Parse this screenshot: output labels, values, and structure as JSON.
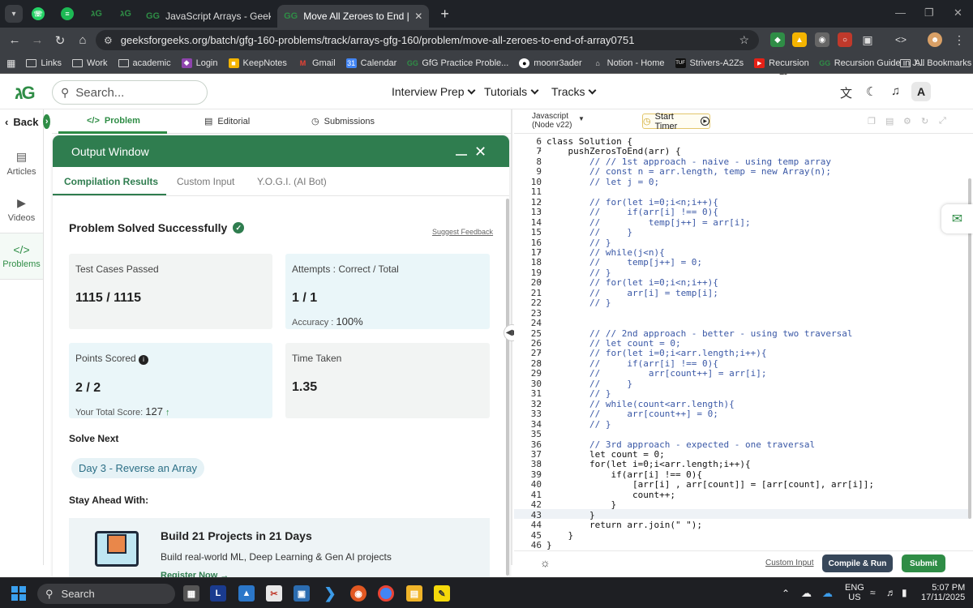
{
  "browser": {
    "tabs": [
      {
        "label": "JavaScript Arrays - GeeksforGee",
        "active": false
      },
      {
        "label": "Move All Zeroes to End | Practic",
        "active": true
      }
    ],
    "url": "geeksforgeeks.org/batch/gfg-160-problems/track/arrays-gfg-160/problem/move-all-zeroes-to-end-of-array0751",
    "extension_badge": "4"
  },
  "bookmarks": [
    "Links",
    "Work",
    "academic",
    "Login",
    "KeepNotes",
    "Gmail",
    "Calendar",
    "GfG Practice Proble...",
    "moonr3ader",
    "Notion - Home",
    "Strivers-A2Zs",
    "Recursion",
    "Recursion Guide in J...",
    "All Bookmarks"
  ],
  "header": {
    "search_placeholder": "Search...",
    "nav": [
      "Interview Prep",
      "Tutorials",
      "Tracks"
    ],
    "avatar": "A"
  },
  "sidebar": {
    "back": "Back",
    "items": [
      {
        "label": "Articles",
        "icon": "book-icon"
      },
      {
        "label": "Videos",
        "icon": "video-icon"
      },
      {
        "label": "Problems",
        "icon": "code-icon"
      }
    ]
  },
  "problem_tabs": [
    "Problem",
    "Editorial",
    "Submissions"
  ],
  "output": {
    "title": "Output Window",
    "tabs": [
      "Compilation Results",
      "Custom Input",
      "Y.O.G.I. (AI Bot)"
    ],
    "status": "Problem Solved Successfully",
    "feedback": "Suggest Feedback",
    "cards": {
      "tests_label": "Test Cases Passed",
      "tests_value": "1115 / 1115",
      "attempts_label": "Attempts : Correct / Total",
      "attempts_value": "1 / 1",
      "accuracy_label": "Accuracy :",
      "accuracy_value": "100%",
      "points_label": "Points Scored",
      "points_value": "2 / 2",
      "total_label": "Your Total Score:",
      "total_value": "127",
      "time_label": "Time Taken",
      "time_value": "1.35"
    },
    "solve_next": "Solve Next",
    "next_problem": "Day 3 - Reverse an Array",
    "stay_ahead": "Stay Ahead With:",
    "promo_title": "Build 21 Projects in 21 Days",
    "promo_sub": "Build real-world ML, Deep Learning & Gen AI projects",
    "promo_link": "Register Now →"
  },
  "editor": {
    "language_line1": "Javascript",
    "language_line2": "(Node v22)",
    "timer": "Start Timer",
    "custom_input": "Custom Input",
    "compile": "Compile & Run",
    "submit": "Submit",
    "lines": [
      {
        "n": "6",
        "t": "class Solution {"
      },
      {
        "n": "7",
        "t": "    pushZerosToEnd(arr) {"
      },
      {
        "n": "8",
        "t": "        // // 1st approach - naive - using temp array"
      },
      {
        "n": "9",
        "t": "        // const n = arr.length, temp = new Array(n);"
      },
      {
        "n": "10",
        "t": "        // let j = 0;"
      },
      {
        "n": "11",
        "t": ""
      },
      {
        "n": "12",
        "t": "        // for(let i=0;i<n;i++){"
      },
      {
        "n": "13",
        "t": "        //     if(arr[i] !== 0){"
      },
      {
        "n": "14",
        "t": "        //         temp[j++] = arr[i];"
      },
      {
        "n": "15",
        "t": "        //     }"
      },
      {
        "n": "16",
        "t": "        // }"
      },
      {
        "n": "17",
        "t": "        // while(j<n){"
      },
      {
        "n": "18",
        "t": "        //     temp[j++] = 0;"
      },
      {
        "n": "19",
        "t": "        // }"
      },
      {
        "n": "20",
        "t": "        // for(let i=0;i<n;i++){"
      },
      {
        "n": "21",
        "t": "        //     arr[i] = temp[i];"
      },
      {
        "n": "22",
        "t": "        // }"
      },
      {
        "n": "23",
        "t": ""
      },
      {
        "n": "24",
        "t": ""
      },
      {
        "n": "25",
        "t": "        // // 2nd approach - better - using two traversal"
      },
      {
        "n": "26",
        "t": "        // let count = 0;"
      },
      {
        "n": "27",
        "t": "        // for(let i=0;i<arr.length;i++){"
      },
      {
        "n": "28",
        "t": "        //     if(arr[i] !== 0){"
      },
      {
        "n": "29",
        "t": "        //         arr[count++] = arr[i];"
      },
      {
        "n": "30",
        "t": "        //     }"
      },
      {
        "n": "31",
        "t": "        // }"
      },
      {
        "n": "32",
        "t": "        // while(count<arr.length){"
      },
      {
        "n": "33",
        "t": "        //     arr[count++] = 0;"
      },
      {
        "n": "34",
        "t": "        // }"
      },
      {
        "n": "35",
        "t": ""
      },
      {
        "n": "36",
        "t": "        // 3rd approach - expected - one traversal"
      },
      {
        "n": "37",
        "t": "        let count = 0;"
      },
      {
        "n": "38",
        "t": "        for(let i=0;i<arr.length;i++){"
      },
      {
        "n": "39",
        "t": "            if(arr[i] !== 0){"
      },
      {
        "n": "40",
        "t": "                [arr[i] , arr[count]] = [arr[count], arr[i]];"
      },
      {
        "n": "41",
        "t": "                count++;"
      },
      {
        "n": "42",
        "t": "            }"
      },
      {
        "n": "43",
        "t": "        }"
      },
      {
        "n": "44",
        "t": "        return arr.join(\" \");"
      },
      {
        "n": "45",
        "t": "    }"
      },
      {
        "n": "46",
        "t": "}"
      }
    ]
  },
  "taskbar": {
    "search": "Search",
    "lang1": "ENG",
    "lang2": "US",
    "time": "5:07 PM",
    "date": "17/11/2025"
  },
  "colors": {
    "brand": "#2f8d46",
    "output_header": "#2f7d4f",
    "compile": "#37475a"
  }
}
